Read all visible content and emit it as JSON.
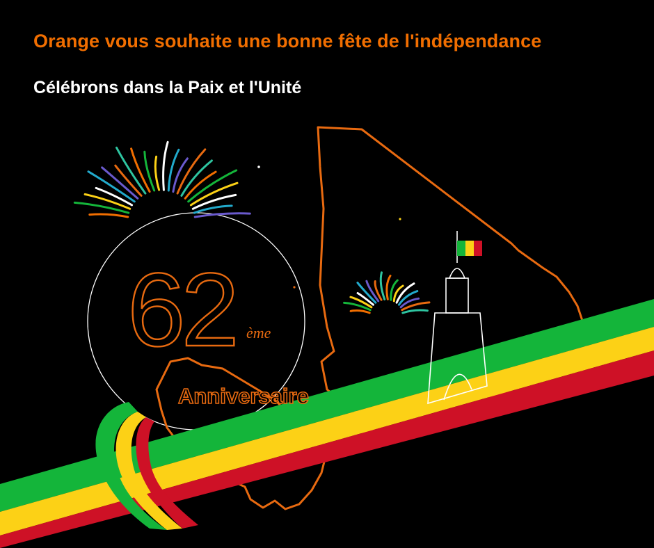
{
  "header": {
    "headline": "Orange vous souhaite une bonne fête de l'indépendance",
    "subline": "Célébrons dans la Paix et l'Unité"
  },
  "badge": {
    "number": "62",
    "suffix": "ème",
    "label": "Anniversaire"
  },
  "colors": {
    "brand": "#f16e00",
    "flag_green": "#14b53a",
    "flag_yellow": "#fcd116",
    "flag_red": "#ce1126",
    "outline": "#e86a10"
  },
  "icons": [
    "fireworks-icon",
    "mali-map-outline",
    "monument-icon",
    "mali-flag-icon",
    "flag-ribbon"
  ]
}
